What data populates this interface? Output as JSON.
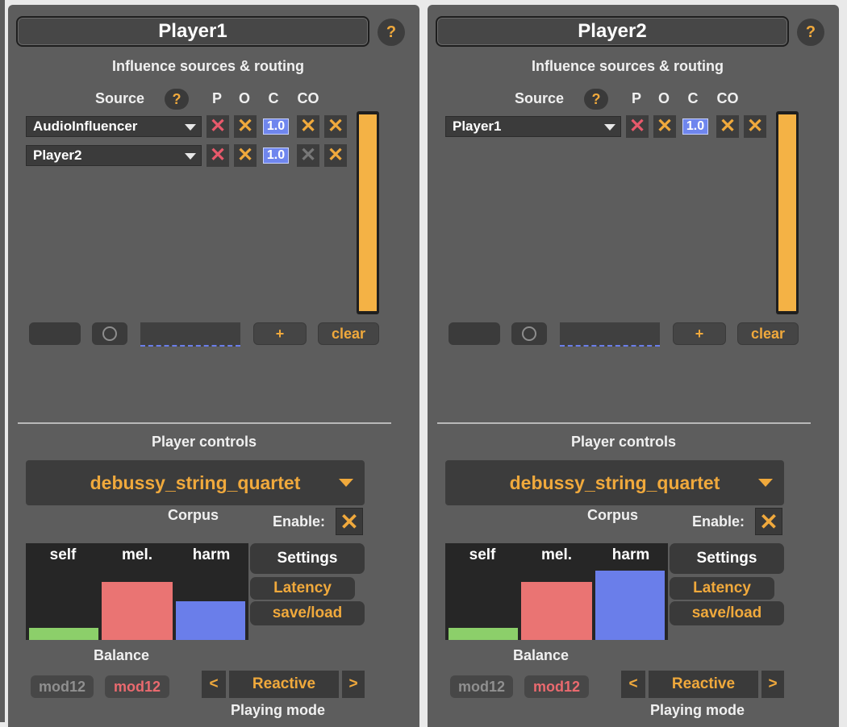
{
  "colors": {
    "accent": "#f0a93c",
    "panel": "#5d5d5d",
    "cross_red": "#e8596b",
    "self_green": "#8ccf6a",
    "mel_red": "#ea7473",
    "harm_blue": "#6a7eea"
  },
  "common": {
    "help": "?",
    "section_influence": "Influence sources & routing",
    "source_label": "Source",
    "col_p": "P",
    "col_o": "O",
    "col_c": "C",
    "col_co": "CO",
    "cross": "✕",
    "plus": "+",
    "clear": "clear",
    "player_controls": "Player controls",
    "corpus_label": "Corpus",
    "enable_label": "Enable:",
    "bal_self": "self",
    "bal_mel": "mel.",
    "bal_harm": "harm",
    "balance_label": "Balance",
    "settings": "Settings",
    "latency": "Latency",
    "saveload": "save/load",
    "mod_off": "mod12",
    "mod_on": "mod12",
    "prev": "<",
    "next": ">",
    "playing_mode_label": "Playing mode"
  },
  "players": [
    {
      "title": "Player1",
      "sources": [
        {
          "name": "AudioInfluencer",
          "c": "1.0",
          "c_o_active": true
        },
        {
          "name": "Player2",
          "c": "1.0",
          "c_o_active": false
        }
      ],
      "corpus": "debussy_string_quartet",
      "balance": {
        "self": 0.25,
        "mel": 0.6,
        "harm": 0.4
      },
      "playing_mode": "Reactive"
    },
    {
      "title": "Player2",
      "sources": [
        {
          "name": "Player1",
          "c": "1.0",
          "c_o_active": true
        }
      ],
      "corpus": "debussy_string_quartet",
      "balance": {
        "self": 0.25,
        "mel": 0.6,
        "harm": 0.72
      },
      "playing_mode": "Reactive"
    }
  ]
}
